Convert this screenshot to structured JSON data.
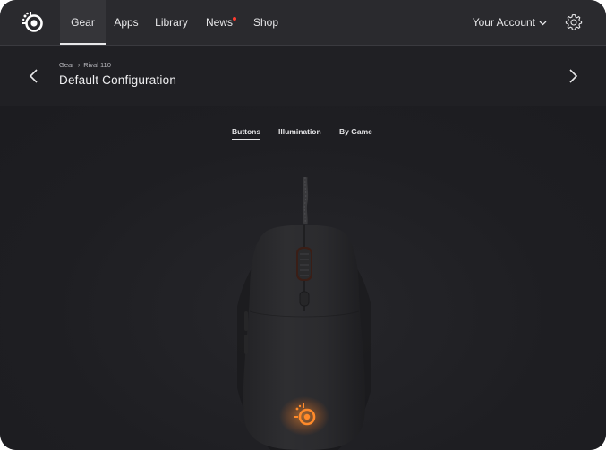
{
  "nav": {
    "tabs": [
      {
        "label": "Gear",
        "active": true
      },
      {
        "label": "Apps",
        "active": false
      },
      {
        "label": "Library",
        "active": false
      },
      {
        "label": "News",
        "active": false,
        "badge": true
      },
      {
        "label": "Shop",
        "active": false
      }
    ],
    "account_label": "Your Account",
    "icons": {
      "logo": "steelseries-logo-icon",
      "settings": "gear-icon",
      "account_dropdown": "chevron-down-icon"
    }
  },
  "header": {
    "breadcrumb": [
      "Gear",
      "Rival 110"
    ],
    "title": "Default Configuration"
  },
  "subtabs": [
    {
      "label": "Buttons",
      "active": true
    },
    {
      "label": "Illumination",
      "active": false
    },
    {
      "label": "By Game",
      "active": false
    }
  ],
  "colors": {
    "background": "#1f1f23",
    "topbar": "#2a2a2e",
    "accent_badge": "#ff3b2f",
    "mouse_glow": "#ff7a1a"
  }
}
